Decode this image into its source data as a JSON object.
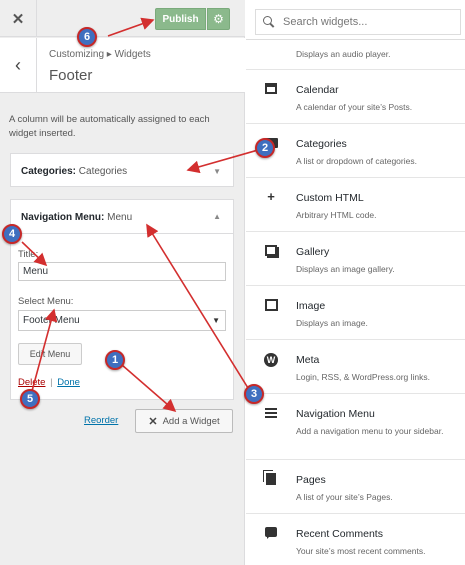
{
  "header": {
    "close_glyph": "✕",
    "publish_label": "Publish",
    "settings_icon": "gear-icon"
  },
  "section": {
    "breadcrumb": "Customizing ▸ Widgets",
    "title": "Footer",
    "description": "A column will be automatically assigned to each widget inserted."
  },
  "widgets": {
    "categories": {
      "type": "Categories:",
      "title": "Categories"
    },
    "nav_menu": {
      "type": "Navigation Menu:",
      "title": "Menu",
      "title_label": "Title:",
      "title_value": "Menu",
      "select_label": "Select Menu:",
      "select_value": "Footer Menu",
      "edit_menu_label": "Edit Menu",
      "delete_label": "Delete",
      "separator": "|",
      "done_label": "Done"
    }
  },
  "actions": {
    "reorder_label": "Reorder",
    "add_widget_label": "Add a Widget"
  },
  "available": {
    "search_placeholder": "Search widgets...",
    "items": [
      {
        "name": "",
        "desc": "Displays an audio player.",
        "icon": "audio-icon"
      },
      {
        "name": "Calendar",
        "desc": "A calendar of your site’s Posts.",
        "icon": "calendar-icon"
      },
      {
        "name": "Categories",
        "desc": "A list or dropdown of categories.",
        "icon": "folder-icon"
      },
      {
        "name": "Custom HTML",
        "desc": "Arbitrary HTML code.",
        "icon": "plus-icon"
      },
      {
        "name": "Gallery",
        "desc": "Displays an image gallery.",
        "icon": "gallery-icon"
      },
      {
        "name": "Image",
        "desc": "Displays an image.",
        "icon": "image-icon"
      },
      {
        "name": "Meta",
        "desc": "Login, RSS, & WordPress.org links.",
        "icon": "wordpress-icon"
      },
      {
        "name": "Navigation Menu",
        "desc": "Add a navigation menu to your sidebar.",
        "icon": "menu-icon"
      },
      {
        "name": "Pages",
        "desc": "A list of your site’s Pages.",
        "icon": "pages-icon"
      },
      {
        "name": "Recent Comments",
        "desc": "Your site’s most recent comments.",
        "icon": "comment-icon"
      }
    ]
  },
  "annotations": {
    "badges": [
      "1",
      "2",
      "3",
      "4",
      "5",
      "6"
    ],
    "color_fill": "#3f6fbf",
    "color_border": "#c62828",
    "arrow_color": "#d32f2f"
  },
  "colors": {
    "publish": "#8bb98c",
    "link": "#0073aa",
    "delete": "#aa0000"
  }
}
